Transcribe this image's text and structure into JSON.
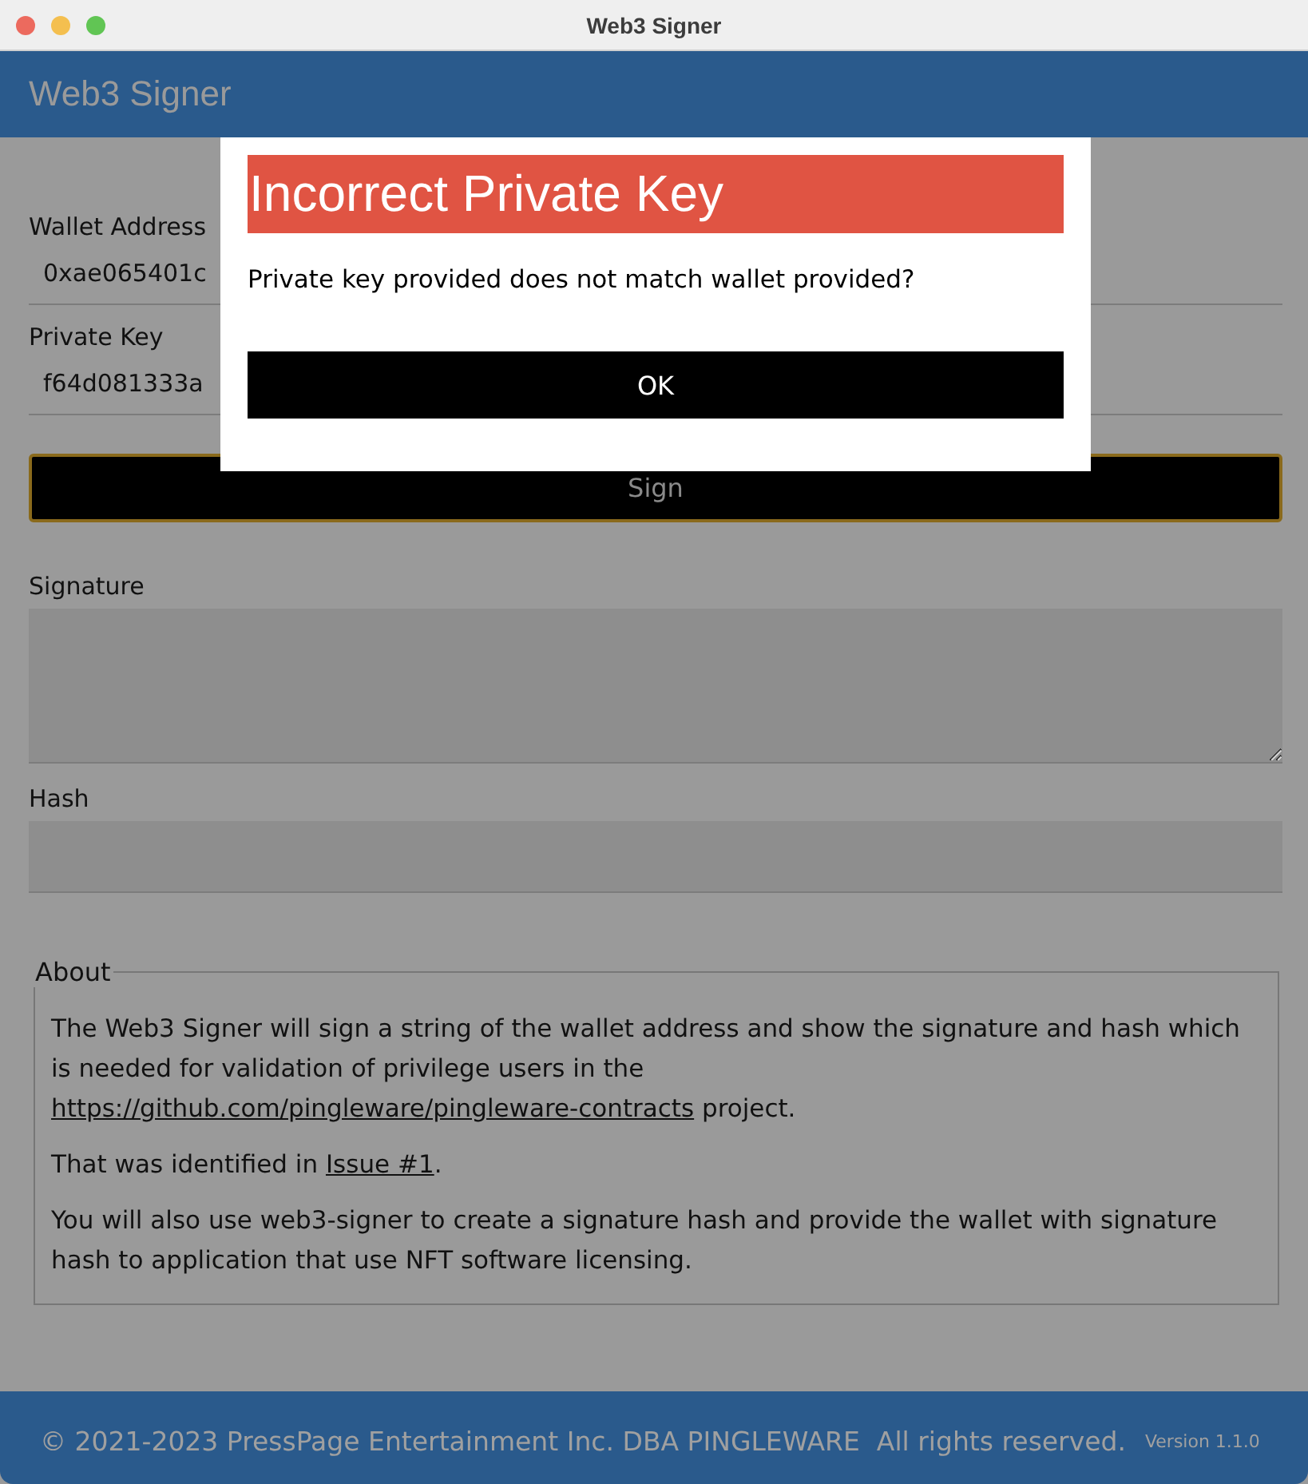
{
  "window": {
    "title": "Web3 Signer"
  },
  "header": {
    "title": "Web3 Signer"
  },
  "fields": [
    {
      "label": "Wallet Address",
      "value": "0xae065401c"
    },
    {
      "label": "Private Key",
      "value": "f64d081333a"
    }
  ],
  "sign_button": "Sign",
  "outputs": [
    {
      "label": "Signature",
      "kind": "textarea"
    },
    {
      "label": "Hash",
      "kind": "input"
    }
  ],
  "about": {
    "legend": "About",
    "paragraphs": [
      [
        {
          "kind": "text",
          "text": "The Web3 Signer will sign a string of the wallet address and show the signature and hash which is needed for validation of privilege users in the "
        },
        {
          "kind": "link",
          "text": "https://github.com/pingleware/pingleware-contracts"
        },
        {
          "kind": "text",
          "text": " project."
        }
      ],
      [
        {
          "kind": "text",
          "text": "That was identified in "
        },
        {
          "kind": "link",
          "text": "Issue #1"
        },
        {
          "kind": "text",
          "text": "."
        }
      ],
      [
        {
          "kind": "text",
          "text": "You will also use web3-signer to create a signature hash and provide the wallet with signature hash to application that use NFT software licensing."
        }
      ]
    ]
  },
  "footer": {
    "copyright": "© 2021-2023 PressPage Entertainment Inc. DBA PINGLEWARE  All rights reserved.",
    "version": "Version 1.1.0"
  },
  "dialog": {
    "title": "Incorrect Private Key",
    "message": "Private key provided does not match wallet provided?",
    "button": "OK"
  }
}
